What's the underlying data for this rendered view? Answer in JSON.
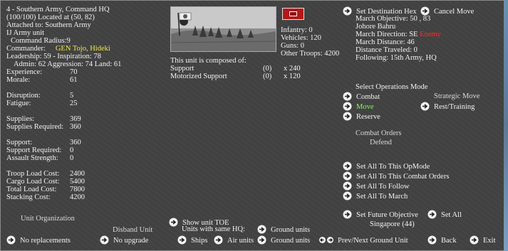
{
  "unit": {
    "title": "4 - Southern Army, Command HQ",
    "location": "(100/100) Located at (50, 82)",
    "attached_prefix": "Attached to: ",
    "attached_to": "Southern Army",
    "type": "IJ Army unit",
    "command_radius": "Command Radius:9",
    "commander_label": "Commander:",
    "commander_name": "GEN Tojo, Hideki",
    "leadership": "Leadership: 59 - Inspiration: 78",
    "admin_line": "Admin: 62  Aggression: 74 Land: 61"
  },
  "stats": [
    {
      "label": "Experience:",
      "value": "70"
    },
    {
      "label": "Morale:",
      "value": "61"
    },
    {
      "label": "Disruption:",
      "value": "5"
    },
    {
      "label": "Fatigue:",
      "value": "25"
    },
    {
      "label": "Supplies:",
      "value": "369"
    },
    {
      "label": "Supplies Required:",
      "value": "360"
    },
    {
      "label": "Support:",
      "value": "360"
    },
    {
      "label": "Support Required:",
      "value": "0"
    },
    {
      "label": "Assault Strength:",
      "value": "0"
    },
    {
      "label": "Troop Load Cost:",
      "value": "2400"
    },
    {
      "label": "Cargo Load Cost:",
      "value": "5400"
    },
    {
      "label": "Total Load Cost:",
      "value": "7800"
    },
    {
      "label": "Stacking Cost:",
      "value": "4200"
    }
  ],
  "composition": {
    "infantry": "Infantry: 0",
    "vehicles": "Vehicles: 120",
    "guns": "Guns: 0",
    "other": "Other Troops: 4200",
    "header": "This unit is composed of:",
    "rows": [
      {
        "name": "Support",
        "count": "(0)",
        "qty": "x 240"
      },
      {
        "name": "Motorized Support",
        "count": "(0)",
        "qty": "x 120"
      }
    ]
  },
  "march": {
    "set_destination": "Set Destination Hex",
    "cancel_move": "Cancel Move",
    "objective": "March Objective: 50 , 83",
    "place": "Johore Bahru",
    "direction_label": "March Direction: SE ",
    "direction_enemy": "Enemy",
    "distance": "March Distance:   46",
    "traveled": "Distance Traveled: 0",
    "following": "Following: 15th Army, HQ"
  },
  "ops": {
    "header": "Select Operations Mode",
    "combat": "Combat",
    "strategic": "Strategic Move",
    "move": "Move",
    "rest": "Rest/Training",
    "reserve": "Reserve",
    "orders_header": "Combat Orders",
    "orders_value": "Defend"
  },
  "set_all": {
    "opmode": "Set All To This OpMode",
    "combat_orders": "Set All To This Combat Orders",
    "follow": "Set All To Follow",
    "march": "Set All To March",
    "future_objective": "Set Future Objective",
    "set_all": "Set All",
    "objective_value": "Singapore (44)"
  },
  "bottom": {
    "unit_org": "Unit Organization",
    "disband": "Disband Unit",
    "show_toe": "Show unit TOE",
    "same_hq": "Units with same HQ:",
    "ground_units_1": "Ground units",
    "no_replacements": "No replacements",
    "no_upgrade": "No upgrade",
    "ships": "Ships",
    "air_units": "Air units",
    "ground_units_2": "Ground units",
    "prev_next": "Prev/Next Ground Unit",
    "back": "Back",
    "exit": "Exit"
  },
  "colors": {
    "highlight_yellow": "#f3e84a",
    "active_green": "#7cff52",
    "enemy_red": "#ff2a2a"
  },
  "icons": {
    "button": "right-arrow-circle-icon",
    "prev_next": "left-right-arrows-icon",
    "flag": "unit-flag-icon"
  }
}
